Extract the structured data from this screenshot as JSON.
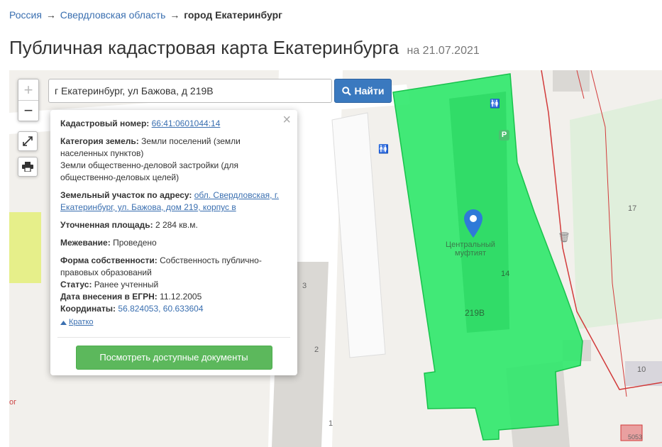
{
  "breadcrumb": {
    "items": [
      "Россия",
      "Свердловская область"
    ],
    "separator": "→",
    "current": "город Екатеринбург"
  },
  "title": {
    "text": "Публичная кадастровая карта Екатеринбурга",
    "date": "на 21.07.2021"
  },
  "search": {
    "value": "г Екатеринбург, ул Бажова, д 219В",
    "button_label": "Найти",
    "icon": "search-icon"
  },
  "zoom": {
    "in": "+",
    "out": "−"
  },
  "tools": {
    "fullscreen_icon": "expand-icon",
    "print_icon": "print-icon"
  },
  "popup": {
    "cadastral_label": "Кадастровый номер:",
    "cadastral_value": "66:41:0601044:14",
    "category_label": "Категория земель:",
    "category_value": "Земли поселений (земли населенных пунктов)",
    "usage_value": "Земли общественно-деловой застройки (для общественно-деловых целей)",
    "address_label": "Земельный участок по адресу:",
    "address_value": "обл. Свердловская, г. Екатеринбург, ул. Бажова, дом 219, корпус в",
    "area_label": "Уточненная площадь:",
    "area_value": "2 284 кв.м.",
    "survey_label": "Межевание:",
    "survey_value": "Проведено",
    "ownership_label": "Форма собственности:",
    "ownership_value": "Собственность публично-правовых образований",
    "status_label": "Статус:",
    "status_value": "Ранее учтенный",
    "egrn_label": "Дата внесения в ЕГРН:",
    "egrn_value": "11.12.2005",
    "coords_label": "Координаты:",
    "coords_value": "56.824053, 60.633604",
    "toggle_label": "Кратко",
    "docs_button": "Посмотреть доступные документы"
  },
  "map_labels": {
    "poi_name": "Центральный муфтият",
    "parcel_number": "14",
    "building_number": "219В",
    "house_17": "17",
    "house_10": "10",
    "house_3": "3",
    "house_2": "2",
    "house_1": "1",
    "plot_5053": "5053",
    "edge_text": "ог",
    "parking": "P"
  },
  "colors": {
    "parcel": "#2ee86a",
    "link": "#3a6fb0",
    "search_button": "#3a79bf",
    "docs_button": "#5cb85c",
    "boundary": "#d23a3a",
    "marker": "#2f7ad8"
  }
}
